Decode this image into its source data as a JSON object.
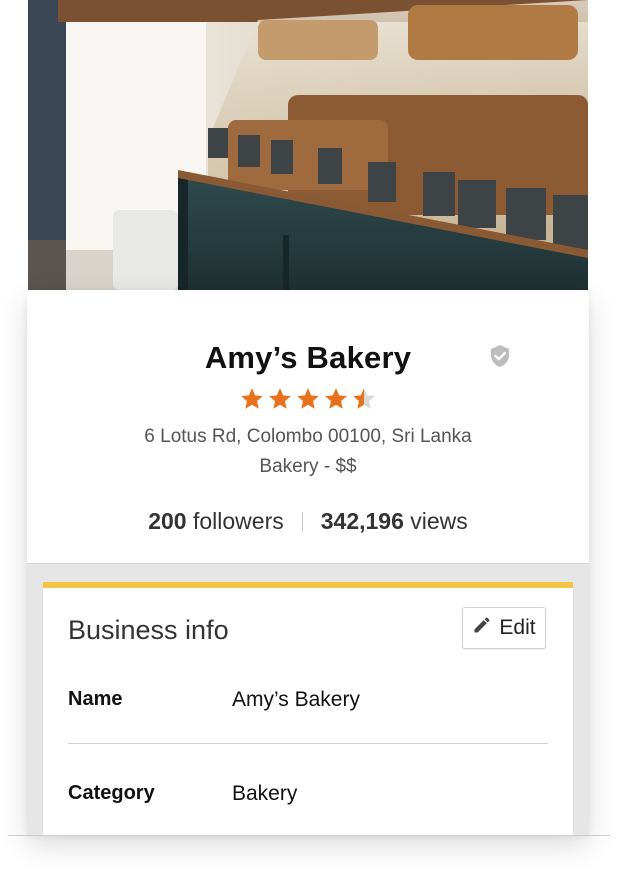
{
  "business": {
    "name": "Amy’s Bakery",
    "rating": 4.5,
    "max_rating": 5,
    "address": "6 Lotus Rd, Colombo 00100, Sri Lanka",
    "category_line": "Bakery - $$",
    "followers_count": "200",
    "followers_label": "followers",
    "views_count": "342,196",
    "views_label": "views"
  },
  "business_info": {
    "title": "Business info",
    "edit_label": "Edit",
    "rows": [
      {
        "label": "Name",
        "value": "Amy’s Bakery"
      },
      {
        "label": "Category",
        "value": "Bakery"
      }
    ]
  },
  "colors": {
    "star": "#e8711c",
    "star_empty": "#d9d9d9",
    "accent_bar": "#f6c443",
    "verified_icon": "#bdbdbd"
  },
  "icons": {
    "verified": "shield-check-icon",
    "edit": "pencil-icon",
    "star": "star-icon"
  }
}
